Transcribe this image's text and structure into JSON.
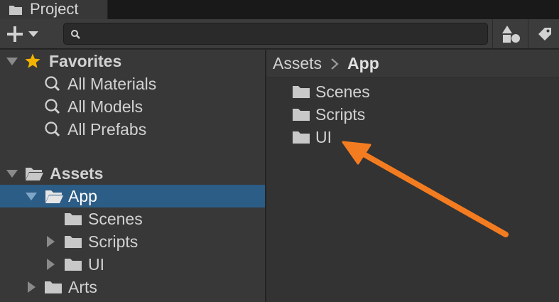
{
  "tab": {
    "title": "Project",
    "icon": "folder-icon"
  },
  "toolbar": {
    "create_icon": "plus-icon",
    "search": {
      "value": "",
      "placeholder": ""
    },
    "filter_type_icon": "shapes-icon",
    "filter_label_icon": "tag-icon"
  },
  "tree": {
    "favorites": {
      "label": "Favorites",
      "items": [
        {
          "label": "All Materials"
        },
        {
          "label": "All Models"
        },
        {
          "label": "All Prefabs"
        }
      ]
    },
    "assets": {
      "label": "Assets",
      "app": {
        "label": "App",
        "children": [
          {
            "label": "Scenes"
          },
          {
            "label": "Scripts"
          },
          {
            "label": "UI"
          }
        ]
      },
      "arts": {
        "label": "Arts"
      }
    }
  },
  "breadcrumb": {
    "root": "Assets",
    "current": "App"
  },
  "content": {
    "items": [
      "Scenes",
      "Scripts",
      "UI"
    ]
  },
  "colors": {
    "selection": "#2c5d87",
    "favorite_star": "#f2b400",
    "annotation_arrow": "#f47c20",
    "folder": "#c8c8c8"
  }
}
